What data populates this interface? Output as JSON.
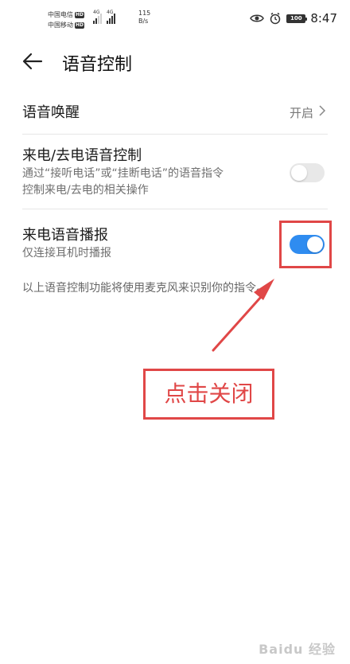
{
  "status_bar": {
    "carrier_1": "中国电信",
    "carrier_2": "中国移动",
    "carrier_1_badge": "HD",
    "carrier_2_badge": "HD",
    "signal_1_label": "4G",
    "signal_2_label": "4G",
    "speed_value": "115",
    "speed_unit": "B/s",
    "battery_text": "100",
    "time": "8:47",
    "icons": [
      "eye-icon",
      "alarm-icon",
      "battery-icon"
    ]
  },
  "header": {
    "title": "语音控制"
  },
  "settings": {
    "voice_wakeup": {
      "label": "语音唤醒",
      "value": "开启"
    },
    "call_voice_control": {
      "label": "来电/去电语音控制",
      "description_line_1": "通过“接听电话”或“挂断电话”的语音指令",
      "description_line_2": "控制来电/去电的相关操作",
      "toggle_state": "off"
    },
    "incoming_call_announcement": {
      "label": "来电语音播报",
      "description": "仅连接耳机时播报",
      "toggle_state": "on"
    }
  },
  "footer_note": "以上语音控制功能将使用麦克风来识别你的指令。",
  "annotation": {
    "callout": "点击关闭",
    "color": "#e04747"
  },
  "watermark": {
    "text": "Baidu 经验"
  },
  "colors": {
    "accent": "#2f8cf0",
    "annotation_red": "#e04747"
  }
}
